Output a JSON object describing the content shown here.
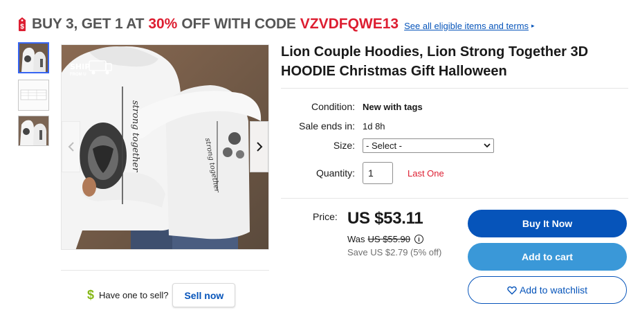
{
  "promo": {
    "prefix": "BUY 3, GET 1 AT",
    "percent": "30%",
    "suffix": "OFF WITH CODE",
    "code": "VZVDFQWE13",
    "link": "See all eligible items and terms",
    "arrow": "▸",
    "tag_icon": "sale-tag-icon"
  },
  "gallery": {
    "selected_index": 0,
    "thumbnail_count": 3,
    "main_image_alt": "Lion couple hoodies worn by a couple, back view",
    "badge_text": "SHIP",
    "badge_sub": "FROM U",
    "hoodie_text_1": "strong together",
    "hoodie_text_2": "strong together"
  },
  "sell": {
    "question": "Have one to sell?",
    "button": "Sell now",
    "icon": "$"
  },
  "product": {
    "title": "Lion Couple Hoodies, Lion Strong Together 3D HOODIE Christmas Gift Halloween"
  },
  "details": {
    "condition_label": "Condition:",
    "condition_value": "New with tags",
    "sale_label": "Sale ends in:",
    "sale_value": "1d 8h",
    "size_label": "Size:",
    "size_selected": "- Select -",
    "quantity_label": "Quantity:",
    "quantity_value": "1",
    "stock_note": "Last One"
  },
  "pricing": {
    "label": "Price:",
    "price": "US $53.11",
    "was_label": "Was",
    "was_price": "US $55.90",
    "save_text": "Save US $2.79 (5% off)"
  },
  "actions": {
    "buy_now": "Buy It Now",
    "add_to_cart": "Add to cart",
    "watchlist": "Add to watchlist"
  },
  "colors": {
    "brand_blue": "#0654ba",
    "cart_blue": "#3a98d8",
    "promo_red": "#dd1e31",
    "selected_thumb": "#3665f3"
  }
}
